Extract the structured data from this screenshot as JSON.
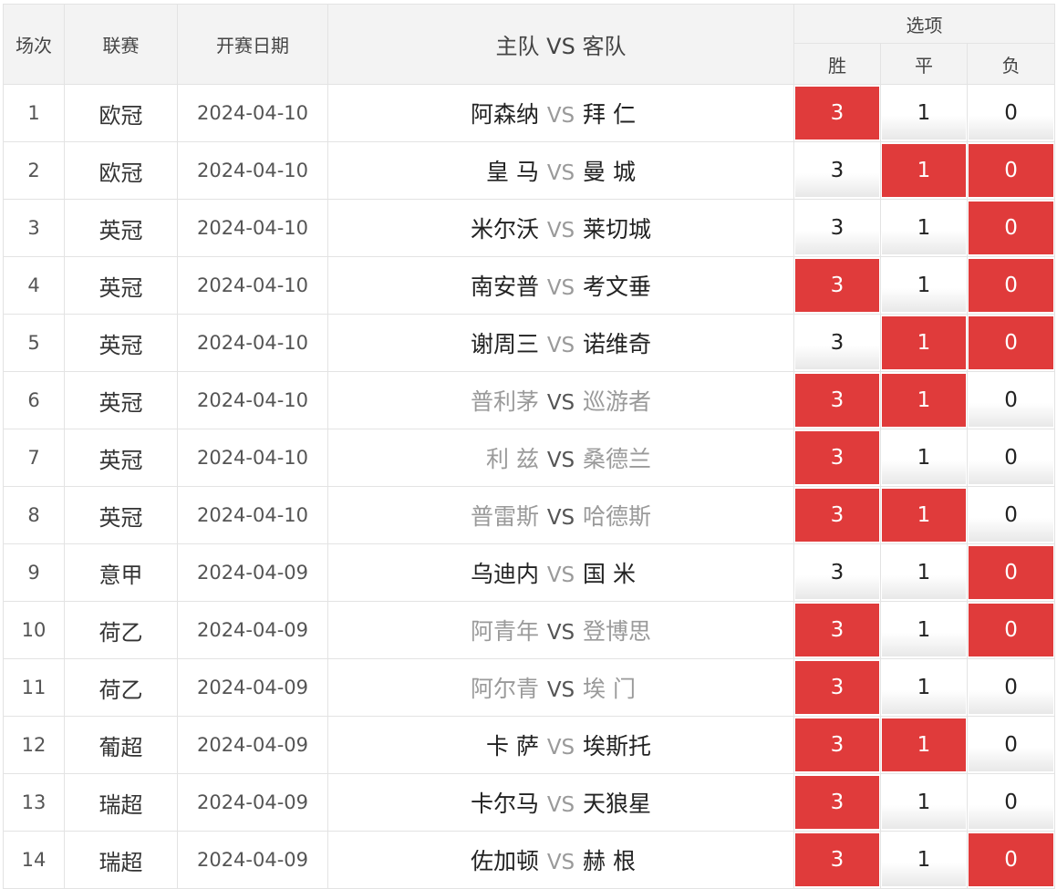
{
  "header": {
    "col_index": "场次",
    "col_league": "联赛",
    "col_date": "开赛日期",
    "col_match": "主队 VS 客队",
    "col_options": "选项",
    "opt_win": "胜",
    "opt_draw": "平",
    "opt_lose": "负"
  },
  "vs_label": "VS",
  "colors": {
    "selected": "#e03b3b",
    "header_bg": "#f3f3f3"
  },
  "rows": [
    {
      "no": "1",
      "league": "欧冠",
      "date": "2024-04-10",
      "home": "阿森纳",
      "away": "拜 仁",
      "dim": false,
      "win": "3",
      "draw": "1",
      "lose": "0",
      "sel": [
        true,
        false,
        false
      ]
    },
    {
      "no": "2",
      "league": "欧冠",
      "date": "2024-04-10",
      "home": "皇 马",
      "away": "曼 城",
      "dim": false,
      "win": "3",
      "draw": "1",
      "lose": "0",
      "sel": [
        false,
        true,
        true
      ]
    },
    {
      "no": "3",
      "league": "英冠",
      "date": "2024-04-10",
      "home": "米尔沃",
      "away": "莱切城",
      "dim": false,
      "win": "3",
      "draw": "1",
      "lose": "0",
      "sel": [
        false,
        false,
        true
      ]
    },
    {
      "no": "4",
      "league": "英冠",
      "date": "2024-04-10",
      "home": "南安普",
      "away": "考文垂",
      "dim": false,
      "win": "3",
      "draw": "1",
      "lose": "0",
      "sel": [
        true,
        false,
        true
      ]
    },
    {
      "no": "5",
      "league": "英冠",
      "date": "2024-04-10",
      "home": "谢周三",
      "away": "诺维奇",
      "dim": false,
      "win": "3",
      "draw": "1",
      "lose": "0",
      "sel": [
        false,
        true,
        true
      ]
    },
    {
      "no": "6",
      "league": "英冠",
      "date": "2024-04-10",
      "home": "普利茅",
      "away": "巡游者",
      "dim": true,
      "win": "3",
      "draw": "1",
      "lose": "0",
      "sel": [
        true,
        true,
        false
      ]
    },
    {
      "no": "7",
      "league": "英冠",
      "date": "2024-04-10",
      "home": "利 兹",
      "away": "桑德兰",
      "dim": true,
      "win": "3",
      "draw": "1",
      "lose": "0",
      "sel": [
        true,
        false,
        false
      ]
    },
    {
      "no": "8",
      "league": "英冠",
      "date": "2024-04-10",
      "home": "普雷斯",
      "away": "哈德斯",
      "dim": true,
      "win": "3",
      "draw": "1",
      "lose": "0",
      "sel": [
        true,
        true,
        false
      ]
    },
    {
      "no": "9",
      "league": "意甲",
      "date": "2024-04-09",
      "home": "乌迪内",
      "away": "国 米",
      "dim": false,
      "win": "3",
      "draw": "1",
      "lose": "0",
      "sel": [
        false,
        false,
        true
      ]
    },
    {
      "no": "10",
      "league": "荷乙",
      "date": "2024-04-09",
      "home": "阿青年",
      "away": "登博思",
      "dim": true,
      "win": "3",
      "draw": "1",
      "lose": "0",
      "sel": [
        true,
        false,
        true
      ]
    },
    {
      "no": "11",
      "league": "荷乙",
      "date": "2024-04-09",
      "home": "阿尔青",
      "away": "埃 门",
      "dim": true,
      "win": "3",
      "draw": "1",
      "lose": "0",
      "sel": [
        true,
        false,
        false
      ]
    },
    {
      "no": "12",
      "league": "葡超",
      "date": "2024-04-09",
      "home": "卡 萨",
      "away": "埃斯托",
      "dim": false,
      "win": "3",
      "draw": "1",
      "lose": "0",
      "sel": [
        true,
        true,
        false
      ]
    },
    {
      "no": "13",
      "league": "瑞超",
      "date": "2024-04-09",
      "home": "卡尔马",
      "away": "天狼星",
      "dim": false,
      "win": "3",
      "draw": "1",
      "lose": "0",
      "sel": [
        true,
        false,
        false
      ]
    },
    {
      "no": "14",
      "league": "瑞超",
      "date": "2024-04-09",
      "home": "佐加顿",
      "away": "赫 根",
      "dim": false,
      "win": "3",
      "draw": "1",
      "lose": "0",
      "sel": [
        true,
        false,
        true
      ]
    }
  ]
}
